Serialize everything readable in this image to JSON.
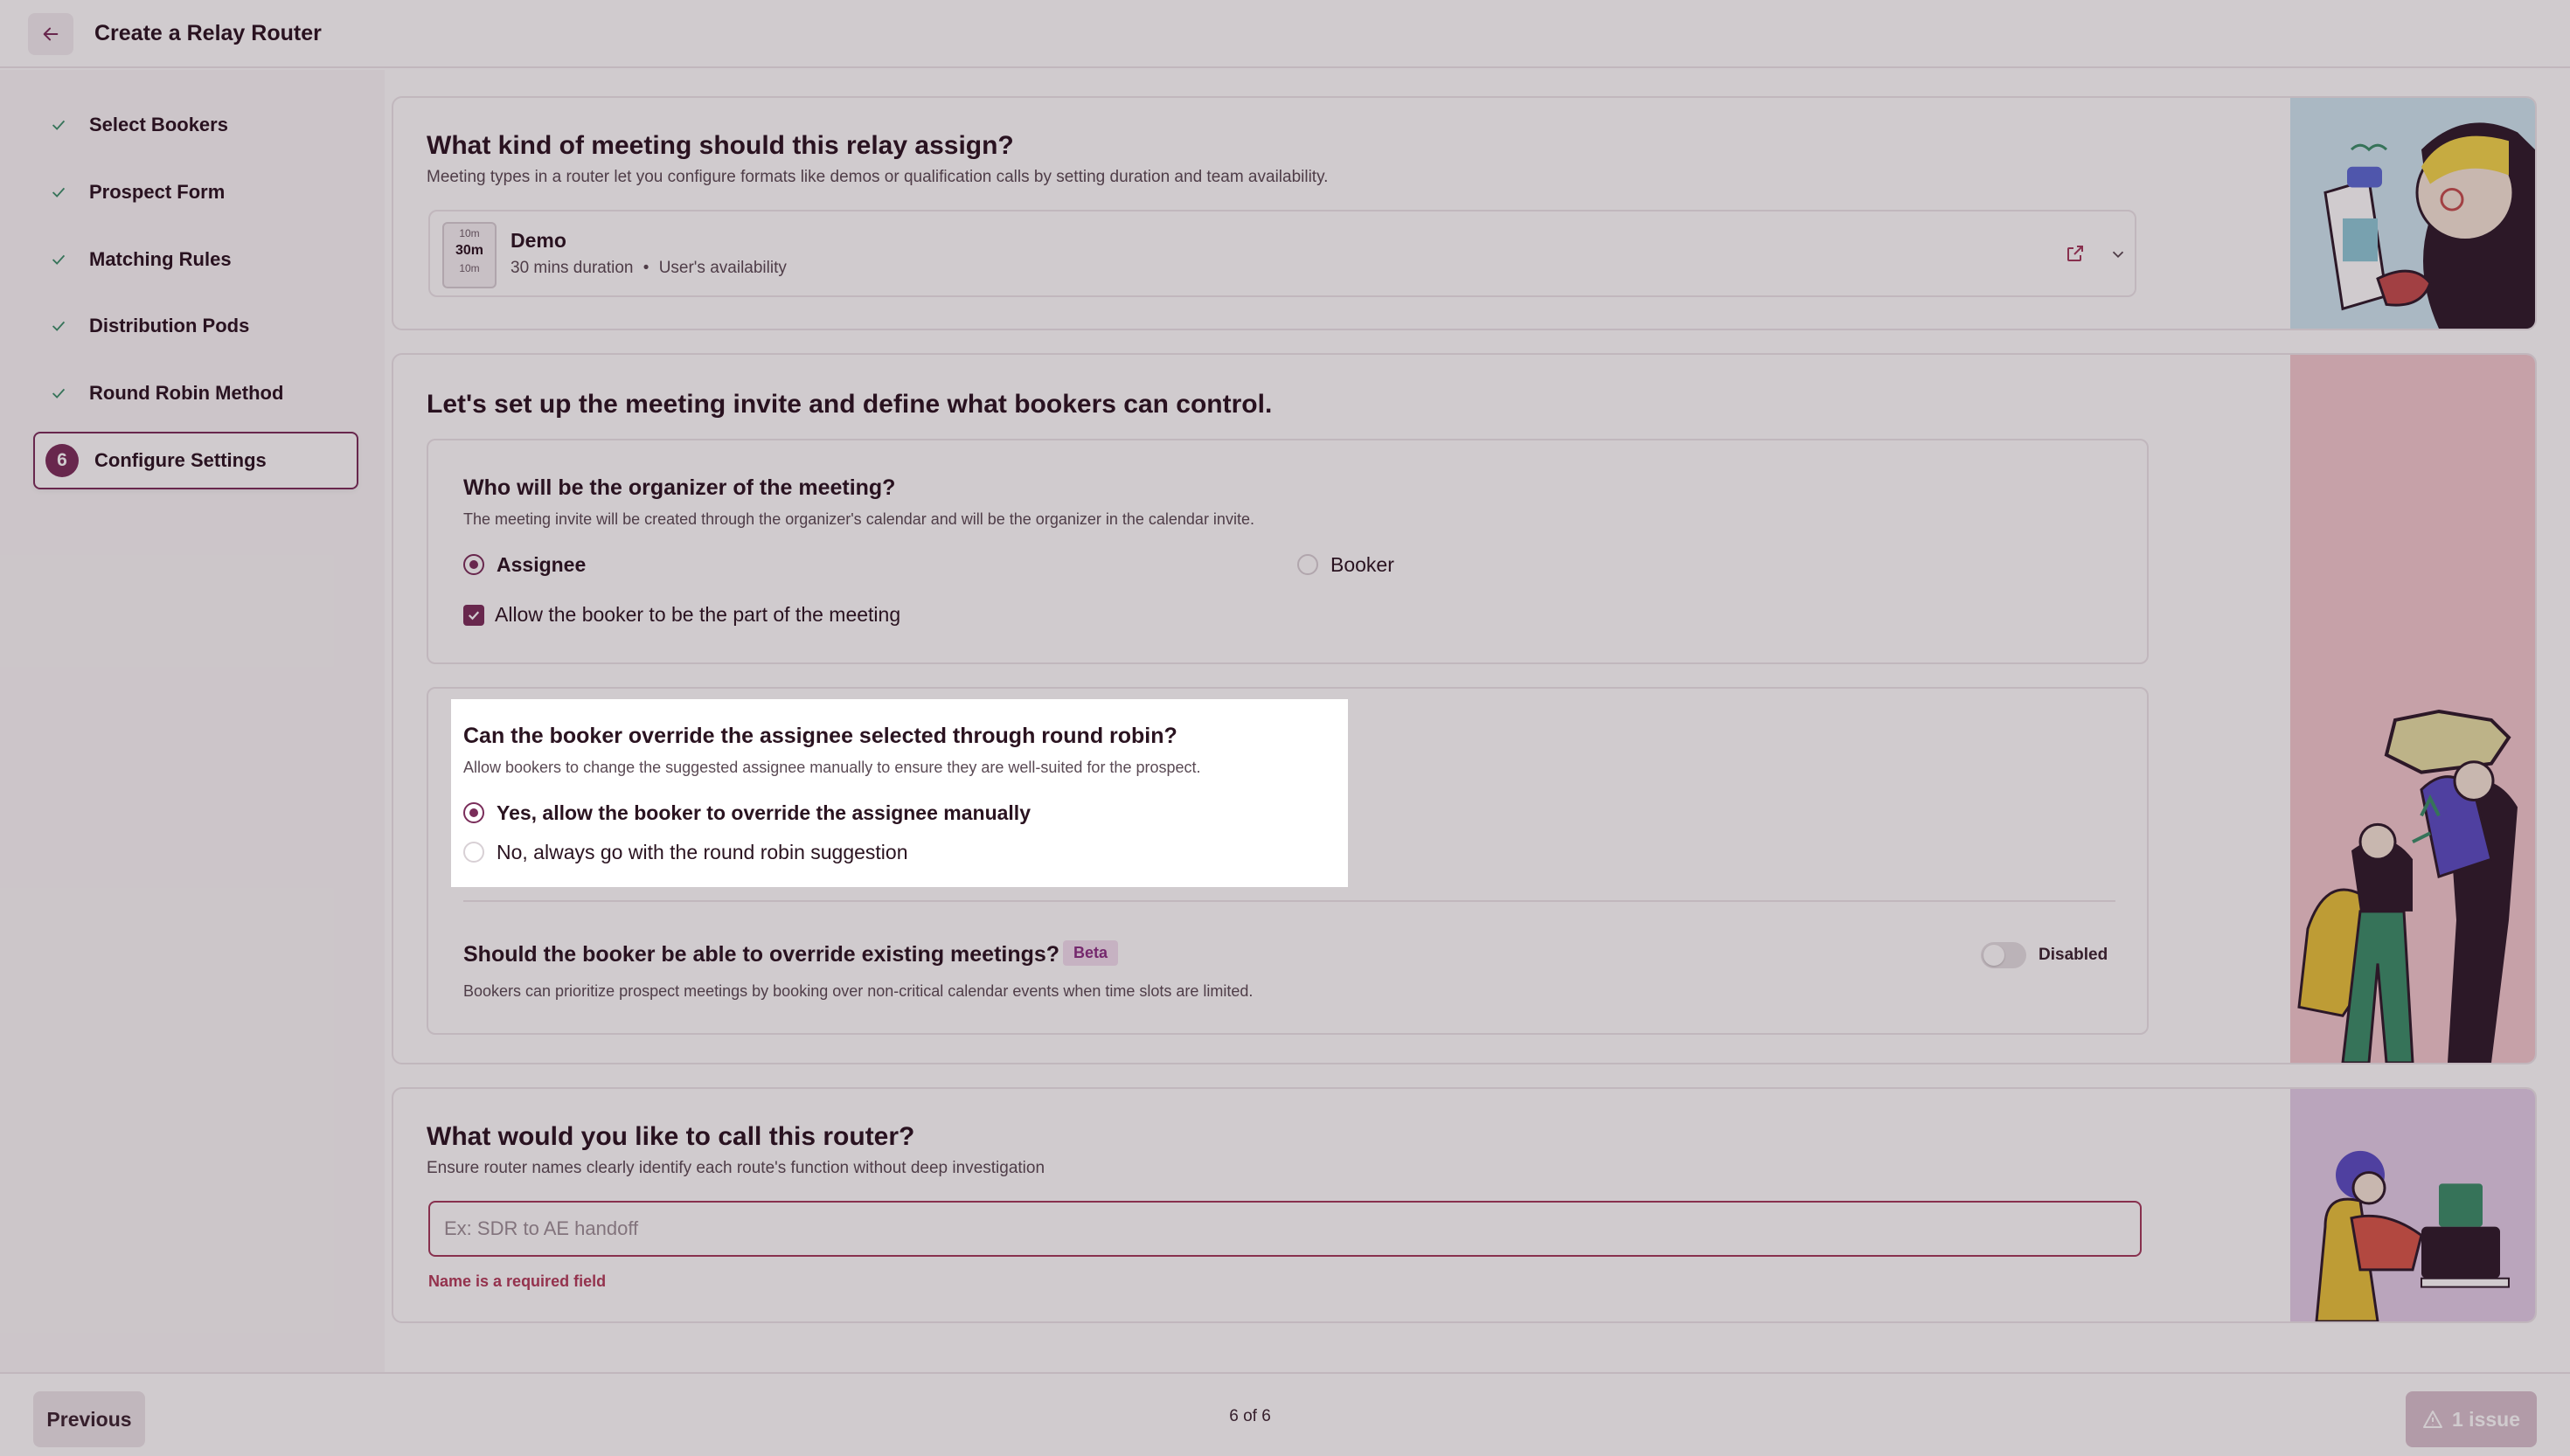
{
  "header": {
    "title": "Create a Relay Router",
    "back_icon": "arrow-left-icon"
  },
  "sidebar": {
    "steps": [
      {
        "label": "Select Bookers",
        "state": "done"
      },
      {
        "label": "Prospect Form",
        "state": "done"
      },
      {
        "label": "Matching Rules",
        "state": "done"
      },
      {
        "label": "Distribution Pods",
        "state": "done"
      },
      {
        "label": "Round Robin Method",
        "state": "done"
      },
      {
        "label": "Configure Settings",
        "state": "active",
        "number": "6"
      }
    ]
  },
  "meeting_type": {
    "title": "What kind of meeting should this relay assign?",
    "description": "Meeting types in a router let you configure formats like demos or qualification calls by setting duration and team availability.",
    "selected": {
      "icon_top": "10m",
      "icon_main": "30m",
      "icon_bottom": "10m",
      "name": "Demo",
      "duration": "30 mins duration",
      "separator": "•",
      "availability": "User's availability"
    }
  },
  "invite": {
    "title": "Let's set up the meeting invite and define what bookers can control.",
    "organizer": {
      "question": "Who will be the organizer of the meeting?",
      "description": "The meeting invite will be created through the organizer's calendar and will be the organizer in the calendar invite.",
      "options": [
        "Assignee",
        "Booker"
      ],
      "selected": "Assignee",
      "checkbox_label": "Allow the booker to be the part of the meeting",
      "checkbox_checked": true
    },
    "override": {
      "question": "Can the booker override the assignee selected through round robin?",
      "description": "Allow bookers to change the suggested assignee manually to ensure they are well-suited for the prospect.",
      "options": [
        "Yes, allow the booker to override the assignee manually",
        "No, always go with the round robin suggestion"
      ],
      "selected": "Yes, allow the booker to override the assignee manually"
    },
    "existing": {
      "question": "Should the booker be able to override existing meetings?",
      "badge": "Beta",
      "toggle_label": "Disabled",
      "description": "Bookers can prioritize prospect meetings by booking over non-critical calendar events when time slots are limited."
    }
  },
  "router_name": {
    "title": "What would you like to call this router?",
    "description": "Ensure router names clearly identify each route's function without deep investigation",
    "placeholder": "Ex: SDR to AE handoff",
    "value": "",
    "error": "Name is a required field"
  },
  "footer": {
    "previous_label": "Previous",
    "pager": "6 of 6",
    "issue_label": "1 issue",
    "issue_icon": "warning-triangle-icon"
  },
  "colors": {
    "accent": "#7a2d5a",
    "error": "#b23b5a",
    "badge_bg": "#f3dff0"
  }
}
